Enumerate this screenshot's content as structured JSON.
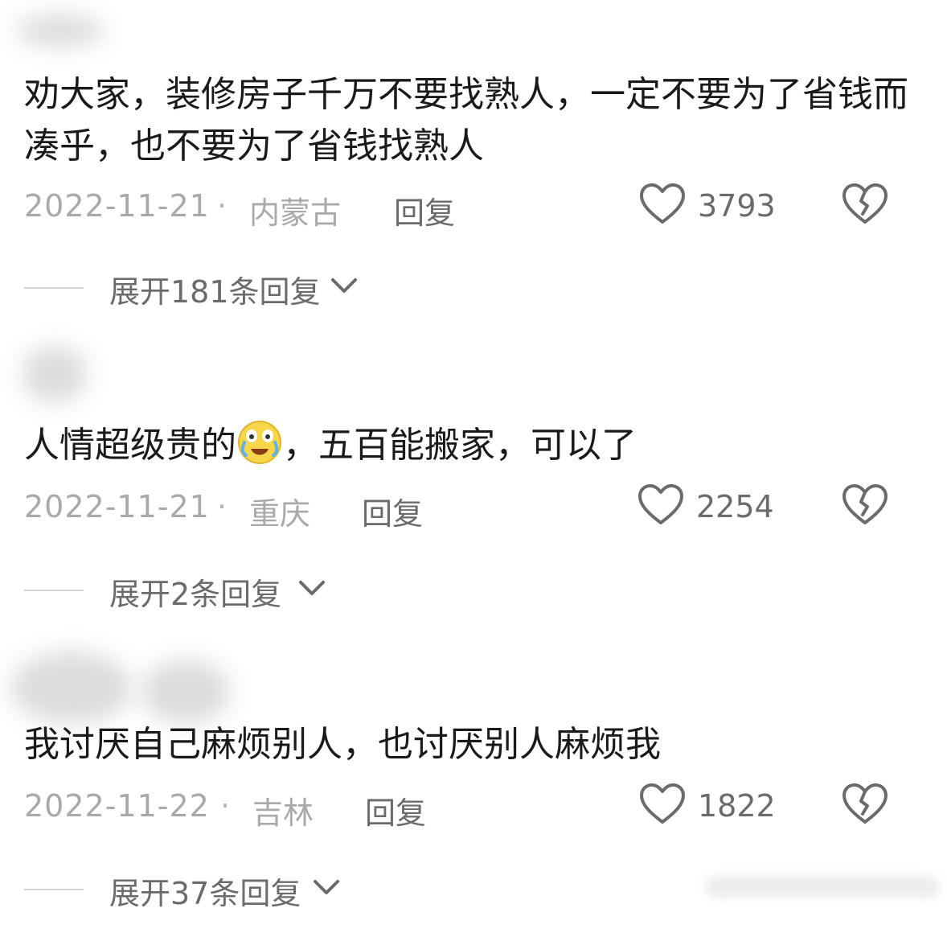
{
  "comments": [
    {
      "text": "劝大家，装修房子千万不要找熟人，一定不要为了省钱而凑乎，也不要为了省钱找熟人",
      "date": "2022-11-21",
      "dot": "·",
      "location": "内蒙古",
      "reply_label": "回复",
      "likes": "3793",
      "expand_label": "展开181条回复"
    },
    {
      "text_before_emoji": "人情超级贵的",
      "emoji": "laughing-crying-face",
      "text_after_emoji": "，五百能搬家，可以了",
      "date": "2022-11-21",
      "dot": "·",
      "location": "重庆",
      "reply_label": "回复",
      "likes": "2254",
      "expand_label": "展开2条回复"
    },
    {
      "text": "我讨厌自己麻烦别人，也讨厌别人麻烦我",
      "date": "2022-11-22",
      "dot": "·",
      "location": "吉林",
      "reply_label": "回复",
      "likes": "1822",
      "expand_label": "展开37条回复"
    }
  ],
  "icons": {
    "like": "heart-outline-icon",
    "dislike": "broken-heart-icon",
    "expand": "chevron-down-icon"
  },
  "colors": {
    "text_primary": "#1a1a1a",
    "text_meta": "#a9a9a9",
    "text_action": "#6b6b6b",
    "divider": "#d4d4d4"
  }
}
